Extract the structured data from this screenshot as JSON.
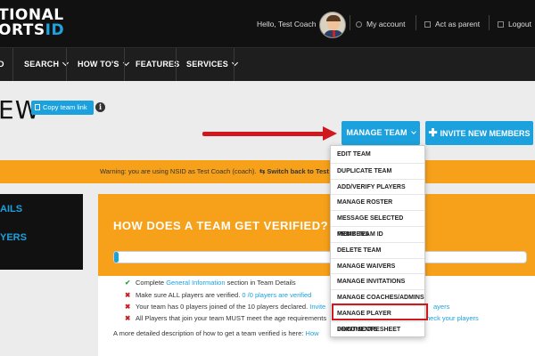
{
  "header": {
    "logo_line1": "TIONAL",
    "logo_line2_a": "ORTS",
    "logo_line2_b": "ID",
    "greeting": "Hello, Test Coach",
    "my_account": "My account",
    "act_as_parent": "Act as parent",
    "logout": "Logout"
  },
  "nav": {
    "items": [
      {
        "label": "D"
      },
      {
        "label": "SEARCH"
      },
      {
        "label": "HOW TO'S"
      },
      {
        "label": "FEATURES"
      },
      {
        "label": "SERVICES"
      }
    ]
  },
  "page": {
    "title": "EW",
    "copy_link": "Copy team link"
  },
  "buttons": {
    "manage_team": "MANAGE TEAM",
    "invite_new_members": "INVITE NEW MEMBERS"
  },
  "warning": {
    "text": "Warning: you are using NSID as Test Coach (coach).",
    "switch": "Switch back to Test"
  },
  "sidebar": {
    "items": [
      {
        "label": "AILS"
      },
      {
        "label": "YERS"
      }
    ]
  },
  "verify": {
    "title": "HOW DOES A TEAM GET VERIFIED?",
    "progress": 0.01,
    "line1_a": "Complete",
    "line1_link": "General Information",
    "line1_b": "section in Team Details",
    "line2_a": "Make sure ALL players are verified.",
    "line2_link": "0 /0 players are verified",
    "line3_a": "Your team has 0 players joined of the 10 players declared.",
    "line3_link": "Invite",
    "line3_tail": "ayers",
    "line4_a": "All Players that join your team MUST meet the age requirements",
    "line4_link": "heck your players",
    "desc": "A more detailed description of how to get a team verified is here:",
    "desc_link": "How"
  },
  "dropdown": {
    "items": [
      "EDIT TEAM",
      "DUPLICATE TEAM",
      "ADD/VERIFY PLAYERS",
      "MANAGE ROSTER",
      "MESSAGE SELECTED MEMBERS",
      "PRINT TEAM ID",
      "DELETE TEAM",
      "MANAGE WAIVERS",
      "MANAGE INVITATIONS",
      "MANAGE COACHES/ADMINS",
      "MANAGE PLAYER DOCUMENTS",
      "PRINT SCORESHEET"
    ],
    "highlighted": "MANAGE PLAYER DOCUMENTS"
  },
  "colors": {
    "accent": "#1ba1dd",
    "warning": "#f7a11a",
    "highlight": "#d0181f"
  }
}
